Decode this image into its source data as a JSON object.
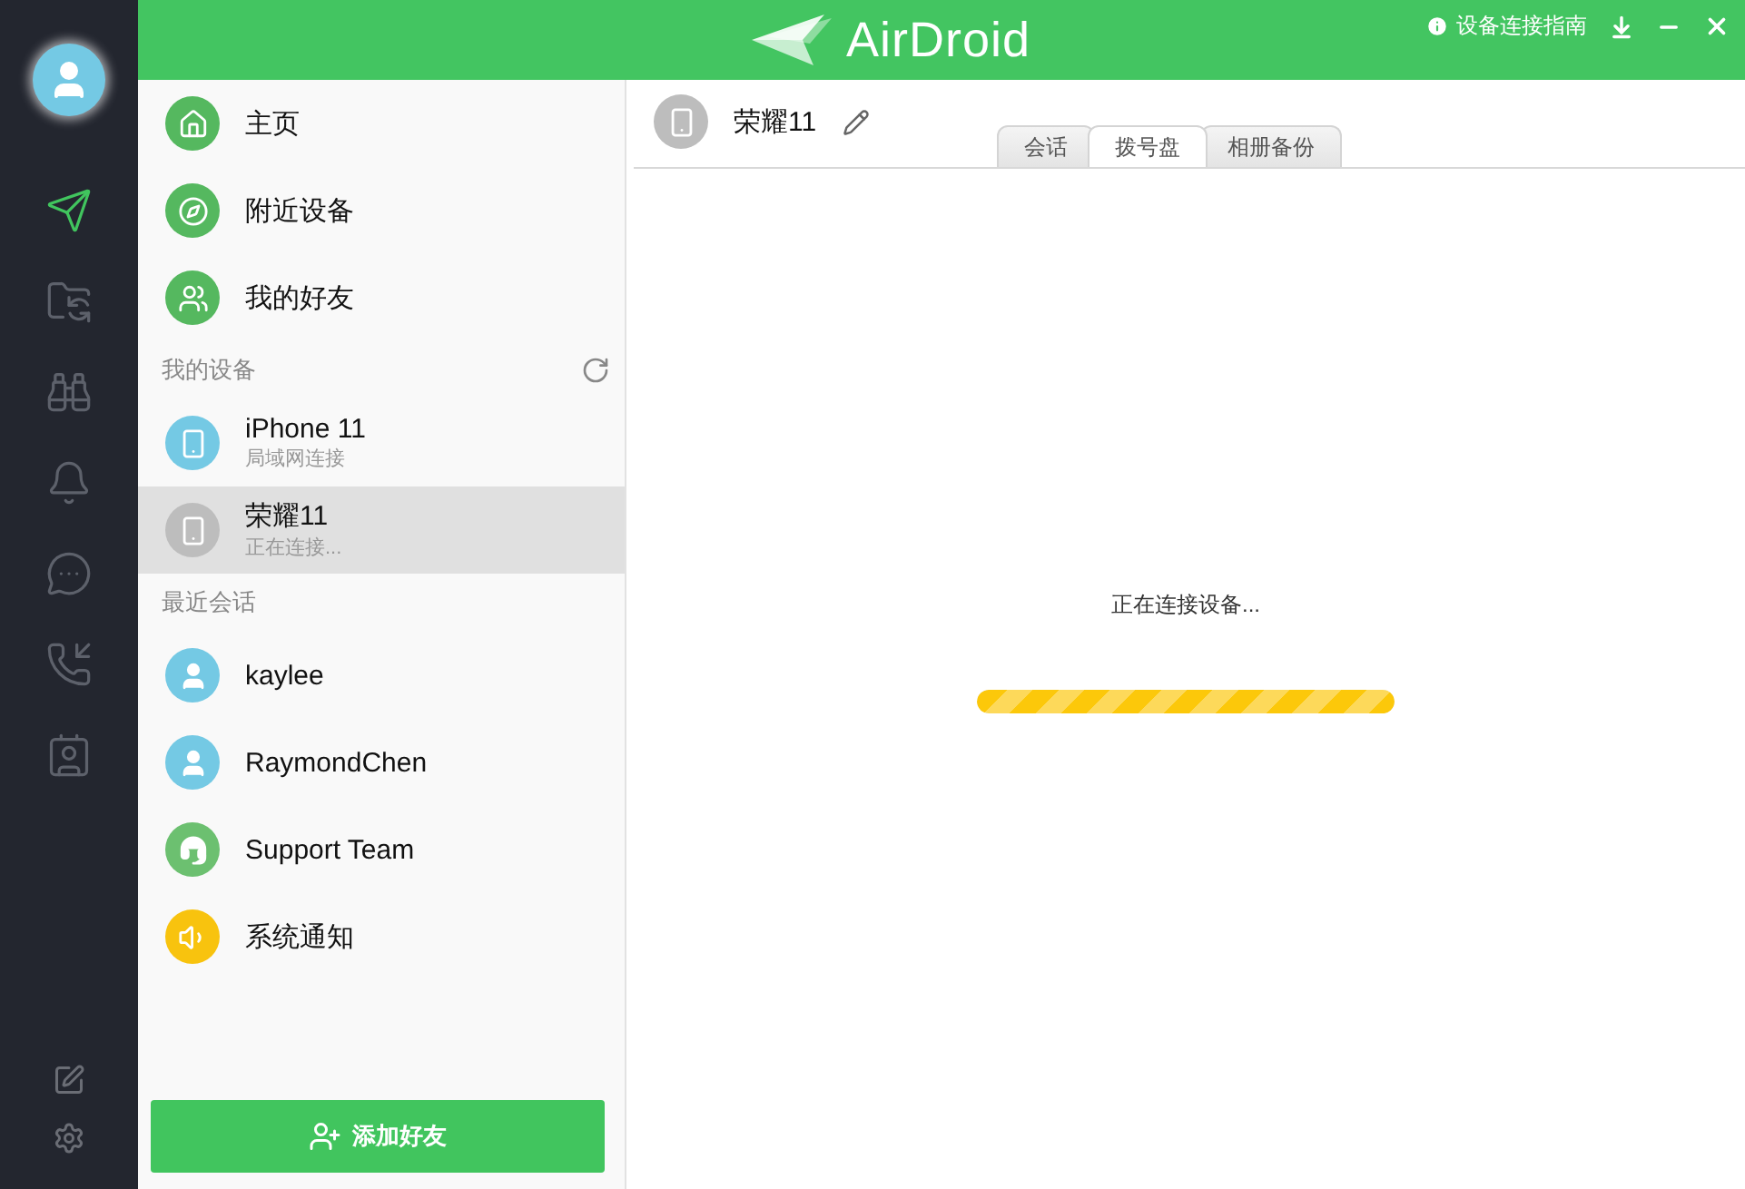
{
  "rail": {
    "nav": [
      {
        "kind": "send",
        "selected": true
      },
      {
        "kind": "files",
        "selected": false
      },
      {
        "kind": "binoculars",
        "selected": false
      },
      {
        "kind": "bell",
        "selected": false
      },
      {
        "kind": "chat",
        "selected": false
      },
      {
        "kind": "calls",
        "selected": false
      },
      {
        "kind": "contacts",
        "selected": false
      }
    ],
    "bottom": [
      {
        "kind": "edit"
      },
      {
        "kind": "settings"
      }
    ]
  },
  "header": {
    "logo": "AirDroid",
    "guide": "设备连接指南"
  },
  "menu": [
    {
      "kind": "home",
      "label": "主页"
    },
    {
      "kind": "compass",
      "label": "附近设备"
    },
    {
      "kind": "friends",
      "label": "我的好友"
    }
  ],
  "devices_title": "我的设备",
  "devices": [
    {
      "name": "iPhone 11",
      "status": "局域网连接",
      "selected": false,
      "color": "#74c9e4"
    },
    {
      "name": "荣耀11",
      "status": "正在连接...",
      "selected": true,
      "color": "#bdbdbd"
    }
  ],
  "recent_title": "最近会话",
  "recent": [
    {
      "kind": "person",
      "name": "kaylee",
      "color": "#74c9e4"
    },
    {
      "kind": "person",
      "name": "RaymondChen",
      "color": "#74c9e4"
    },
    {
      "kind": "support",
      "name": "Support Team",
      "color": "#6cc070"
    },
    {
      "kind": "notice",
      "name": "系统通知",
      "color": "#f8c30e"
    }
  ],
  "add_button": "添加好友",
  "device_header": {
    "name": "荣耀11"
  },
  "tabs": [
    {
      "label": "会话",
      "selected": false
    },
    {
      "label": "拨号盘",
      "selected": true
    },
    {
      "label": "相册备份",
      "selected": false
    }
  ],
  "connecting": {
    "text": "正在连接设备...",
    "level": 1
  }
}
